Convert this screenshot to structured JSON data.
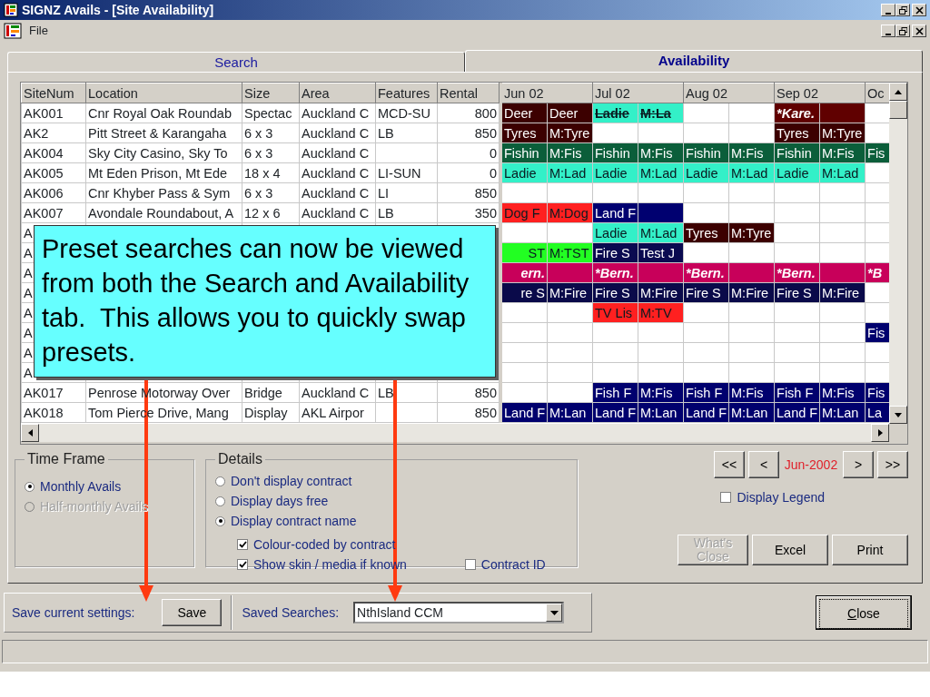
{
  "window": {
    "title": "SIGNZ Avails - [Site Availability]"
  },
  "menu": [
    {
      "label": "File"
    }
  ],
  "tabs": [
    {
      "label": "Search",
      "selected": false
    },
    {
      "label": "Availability",
      "selected": true
    }
  ],
  "grid": {
    "columns": [
      "SiteNum",
      "Location",
      "Size",
      "Area",
      "Features",
      "Rental"
    ],
    "months": [
      "Jun 02",
      "Jul 02",
      "Aug 02",
      "Sep 02",
      "Oc"
    ],
    "rows": [
      {
        "site": "AK001",
        "location": "Cnr Royal Oak Roundab",
        "size": "Spectac",
        "area": "Auckland C",
        "features": "MCD-SU",
        "rental": "800",
        "slots": [
          {
            "text": "Deer",
            "color": "#3c0000",
            "kind": "plain"
          },
          {
            "text": "Deer",
            "color": "#3c0000",
            "kind": "plain"
          },
          {
            "text": "Ladie",
            "color": "#33f0c8",
            "kind": "struck"
          },
          {
            "text": "M:La",
            "color": "#33f0c8",
            "kind": "struck"
          },
          {
            "kind": "free"
          },
          {
            "kind": "free"
          },
          {
            "text": "*Kare.",
            "color": "#600000",
            "kind": "emphasis"
          },
          {
            "color": "#600000",
            "kind": "plain"
          },
          {
            "kind": "free"
          }
        ]
      },
      {
        "site": "AK2",
        "location": "Pitt Street & Karangaha",
        "size": "6 x 3",
        "area": "Auckland C",
        "features": "LB",
        "rental": "850",
        "slots": [
          {
            "text": "Tyres",
            "color": "#3c0000",
            "kind": "plain"
          },
          {
            "text": "M:Tyre",
            "color": "#3c0000",
            "kind": "plain"
          },
          {
            "kind": "free"
          },
          {
            "kind": "free"
          },
          {
            "kind": "free"
          },
          {
            "kind": "free"
          },
          {
            "text": "Tyres",
            "color": "#3c0000",
            "kind": "plain"
          },
          {
            "text": "M:Tyre",
            "color": "#3c0000",
            "kind": "plain"
          },
          {
            "kind": "free"
          }
        ]
      },
      {
        "site": "AK004",
        "location": "Sky City Casino, Sky To",
        "size": "6 x 3",
        "area": "Auckland C",
        "rental": "0",
        "slots": [
          {
            "text": "Fishin",
            "color": "#0b5e3a",
            "kind": "plain"
          },
          {
            "text": "M:Fis",
            "color": "#0b5e3a",
            "kind": "plain"
          },
          {
            "text": "Fishin",
            "color": "#0b5e3a",
            "kind": "plain"
          },
          {
            "text": "M:Fis",
            "color": "#0b5e3a",
            "kind": "plain"
          },
          {
            "text": "Fishin",
            "color": "#0b5e3a",
            "kind": "plain"
          },
          {
            "text": "M:Fis",
            "color": "#0b5e3a",
            "kind": "plain"
          },
          {
            "text": "Fishin",
            "color": "#0b5e3a",
            "kind": "plain"
          },
          {
            "text": "M:Fis",
            "color": "#0b5e3a",
            "kind": "plain"
          },
          {
            "text": "Fis",
            "color": "#0b5e3a",
            "kind": "plain"
          }
        ]
      },
      {
        "site": "AK005",
        "location": "Mt Eden Prison, Mt Ede",
        "size": "18 x 4",
        "area": "Auckland C",
        "features": "LI-SUN",
        "rental": "0",
        "slots": [
          {
            "text": "Ladie",
            "color": "#33f0c8",
            "kind": "plain"
          },
          {
            "text": "M:Lad",
            "color": "#33f0c8",
            "kind": "plain"
          },
          {
            "text": "Ladie",
            "color": "#33f0c8",
            "kind": "plain"
          },
          {
            "text": "M:Lad",
            "color": "#33f0c8",
            "kind": "plain"
          },
          {
            "text": "Ladie",
            "color": "#33f0c8",
            "kind": "plain"
          },
          {
            "text": "M:Lad",
            "color": "#33f0c8",
            "kind": "plain"
          },
          {
            "text": "Ladie",
            "color": "#33f0c8",
            "kind": "plain"
          },
          {
            "text": "M:Lad",
            "color": "#33f0c8",
            "kind": "plain"
          },
          {
            "kind": "free"
          }
        ]
      },
      {
        "site": "AK006",
        "location": "Cnr Khyber Pass & Sym",
        "size": "6 x 3",
        "area": "Auckland C",
        "features": "LI",
        "rental": "850",
        "slots": [
          {
            "kind": "free"
          },
          {
            "kind": "free"
          },
          {
            "kind": "free"
          },
          {
            "kind": "free"
          },
          {
            "kind": "free"
          },
          {
            "kind": "free"
          },
          {
            "kind": "free"
          },
          {
            "kind": "free"
          },
          {
            "kind": "free"
          }
        ]
      },
      {
        "site": "AK007",
        "location": "Avondale Roundabout, A",
        "size": "12 x 6",
        "area": "Auckland C",
        "features": "LB",
        "rental": "350",
        "slots": [
          {
            "text": "Dog F",
            "color": "#ff2020",
            "kind": "plain"
          },
          {
            "text": "M:Dog",
            "color": "#ff2020",
            "kind": "plain"
          },
          {
            "text": "Land F",
            "color": "#000070",
            "kind": "plain"
          },
          {
            "color": "#000070",
            "kind": "plain"
          },
          {
            "kind": "free"
          },
          {
            "kind": "free"
          },
          {
            "kind": "free"
          },
          {
            "kind": "free"
          },
          {
            "kind": "free"
          }
        ]
      },
      {
        "site": "A",
        "slots": [
          {
            "kind": "free"
          },
          {
            "kind": "free"
          },
          {
            "text": "Ladie",
            "color": "#33f0c8",
            "kind": "plain"
          },
          {
            "text": "M:Lad",
            "color": "#33f0c8",
            "kind": "plain"
          },
          {
            "text": "Tyres",
            "color": "#3c0000",
            "kind": "plain"
          },
          {
            "text": "M:Tyre",
            "color": "#3c0000",
            "kind": "plain"
          },
          {
            "kind": "free"
          },
          {
            "kind": "free"
          },
          {
            "kind": "free"
          }
        ]
      },
      {
        "site": "A",
        "slots": [
          {
            "text": "ST",
            "color": "#22ff22",
            "kind": "partial"
          },
          {
            "text": "M:TST",
            "color": "#22ff22",
            "kind": "plain"
          },
          {
            "text": "Fire S",
            "color": "#0a0a50",
            "kind": "plain"
          },
          {
            "text": "Test J",
            "color": "#0a0a50",
            "kind": "plain"
          },
          {
            "kind": "free"
          },
          {
            "kind": "free"
          },
          {
            "kind": "free"
          },
          {
            "kind": "free"
          },
          {
            "kind": "free"
          }
        ]
      },
      {
        "site": "A",
        "slots": [
          {
            "text": "ern.",
            "color": "#c8005a",
            "kind": "partial-emphasis"
          },
          {
            "color": "#c8005a",
            "kind": "plain"
          },
          {
            "text": "*Bern.",
            "color": "#c8005a",
            "kind": "emphasis"
          },
          {
            "color": "#c8005a",
            "kind": "plain"
          },
          {
            "text": "*Bern.",
            "color": "#c8005a",
            "kind": "emphasis"
          },
          {
            "color": "#c8005a",
            "kind": "plain"
          },
          {
            "text": "*Bern.",
            "color": "#c8005a",
            "kind": "emphasis"
          },
          {
            "color": "#c8005a",
            "kind": "plain"
          },
          {
            "text": "*B",
            "color": "#c8005a",
            "kind": "emphasis"
          }
        ]
      },
      {
        "site": "A",
        "slots": [
          {
            "text": "re S",
            "color": "#0a0a4a",
            "kind": "partial"
          },
          {
            "text": "M:Fire",
            "color": "#0a0a4a",
            "kind": "plain"
          },
          {
            "text": "Fire S",
            "color": "#0a0a4a",
            "kind": "plain"
          },
          {
            "text": "M:Fire",
            "color": "#0a0a4a",
            "kind": "plain"
          },
          {
            "text": "Fire S",
            "color": "#0a0a4a",
            "kind": "plain"
          },
          {
            "text": "M:Fire",
            "color": "#0a0a4a",
            "kind": "plain"
          },
          {
            "text": "Fire S",
            "color": "#0a0a4a",
            "kind": "plain"
          },
          {
            "text": "M:Fire",
            "color": "#0a0a4a",
            "kind": "plain"
          },
          {
            "kind": "free"
          }
        ]
      },
      {
        "site": "A",
        "slots": [
          {
            "kind": "free"
          },
          {
            "kind": "free"
          },
          {
            "text": "TV Lis",
            "color": "#ff2020",
            "kind": "plain"
          },
          {
            "text": "M:TV",
            "color": "#ff2020",
            "kind": "plain"
          },
          {
            "kind": "free"
          },
          {
            "kind": "free"
          },
          {
            "kind": "free"
          },
          {
            "kind": "free"
          },
          {
            "kind": "free"
          }
        ]
      },
      {
        "site": "A",
        "slots": [
          {
            "kind": "free"
          },
          {
            "kind": "free"
          },
          {
            "kind": "free"
          },
          {
            "kind": "free"
          },
          {
            "kind": "free"
          },
          {
            "kind": "free"
          },
          {
            "kind": "free"
          },
          {
            "kind": "free"
          },
          {
            "text": "Fis",
            "color": "#00006e",
            "kind": "plain"
          }
        ]
      },
      {
        "site": "A",
        "slots": [
          {
            "kind": "free"
          },
          {
            "kind": "free"
          },
          {
            "kind": "free"
          },
          {
            "kind": "free"
          },
          {
            "kind": "free"
          },
          {
            "kind": "free"
          },
          {
            "kind": "free"
          },
          {
            "kind": "free"
          },
          {
            "kind": "free"
          }
        ]
      },
      {
        "site": "A",
        "slots": [
          {
            "kind": "free"
          },
          {
            "kind": "free"
          },
          {
            "kind": "free"
          },
          {
            "kind": "free"
          },
          {
            "kind": "free"
          },
          {
            "kind": "free"
          },
          {
            "kind": "free"
          },
          {
            "kind": "free"
          },
          {
            "kind": "free"
          }
        ]
      },
      {
        "site": "AK017",
        "location": "Penrose Motorway Over",
        "size": "Bridge",
        "area": "Auckland C",
        "features": "LB",
        "rental": "850",
        "slots": [
          {
            "kind": "free"
          },
          {
            "kind": "free"
          },
          {
            "text": "Fish F",
            "color": "#00006e",
            "kind": "plain"
          },
          {
            "text": "M:Fis",
            "color": "#00006e",
            "kind": "plain"
          },
          {
            "text": "Fish F",
            "color": "#00006e",
            "kind": "plain"
          },
          {
            "text": "M:Fis",
            "color": "#00006e",
            "kind": "plain"
          },
          {
            "text": "Fish F",
            "color": "#00006e",
            "kind": "plain"
          },
          {
            "text": "M:Fis",
            "color": "#00006e",
            "kind": "plain"
          },
          {
            "text": "Fis",
            "color": "#00006e",
            "kind": "plain"
          }
        ]
      },
      {
        "site": "AK018",
        "location": "Tom Pierce Drive, Mang",
        "size": "Display",
        "area": "AKL Airpor",
        "rental": "850",
        "slots": [
          {
            "text": "Land F",
            "color": "#00006e",
            "kind": "plain"
          },
          {
            "text": "M:Lan",
            "color": "#00006e",
            "kind": "plain"
          },
          {
            "text": "Land F",
            "color": "#00006e",
            "kind": "plain"
          },
          {
            "text": "M:Lan",
            "color": "#00006e",
            "kind": "plain"
          },
          {
            "text": "Land F",
            "color": "#00006e",
            "kind": "plain"
          },
          {
            "text": "M:Lan",
            "color": "#00006e",
            "kind": "plain"
          },
          {
            "text": "Land F",
            "color": "#00006e",
            "kind": "plain"
          },
          {
            "text": "M:Lan",
            "color": "#00006e",
            "kind": "plain"
          },
          {
            "text": "La",
            "color": "#00006e",
            "kind": "plain"
          }
        ]
      }
    ]
  },
  "time_frame": {
    "title": "Time Frame",
    "options": [
      {
        "label": "Monthly Avails",
        "selected": true,
        "disabled": false
      },
      {
        "label": "Half-monthly Avails",
        "selected": false,
        "disabled": true
      }
    ]
  },
  "details": {
    "title": "Details",
    "options": [
      {
        "label": "Don't display contract",
        "selected": false
      },
      {
        "label": "Display days free",
        "selected": false
      },
      {
        "label": "Display contract name",
        "selected": true
      }
    ],
    "checks": [
      {
        "label": "Colour-coded by contract",
        "checked": true
      },
      {
        "label": "Show skin / media if known",
        "checked": true
      },
      {
        "label": "Contract ID",
        "checked": false
      }
    ]
  },
  "navigator": [
    {
      "label": "<<",
      "kind": "button"
    },
    {
      "label": "<",
      "kind": "button"
    },
    {
      "label": "Jun-2002",
      "kind": "period"
    },
    {
      "label": ">",
      "kind": "button"
    },
    {
      "label": ">>",
      "kind": "button"
    }
  ],
  "legend_toggle": {
    "label": "Display Legend",
    "checked": false
  },
  "actions": [
    {
      "label": "What's Close",
      "disabled": true
    },
    {
      "label": "Excel",
      "disabled": false
    },
    {
      "label": "Print",
      "disabled": false
    }
  ],
  "save_bar": {
    "label": "Save current settings:",
    "button": "Save",
    "saved_label": "Saved Searches:",
    "saved_value": "NthIsland CCM"
  },
  "close_button": {
    "label": "Close",
    "focused": true
  },
  "callout": {
    "text": "Preset searches can now be viewed from both the Search and Availability tab.  This allows you to quickly swap presets."
  }
}
